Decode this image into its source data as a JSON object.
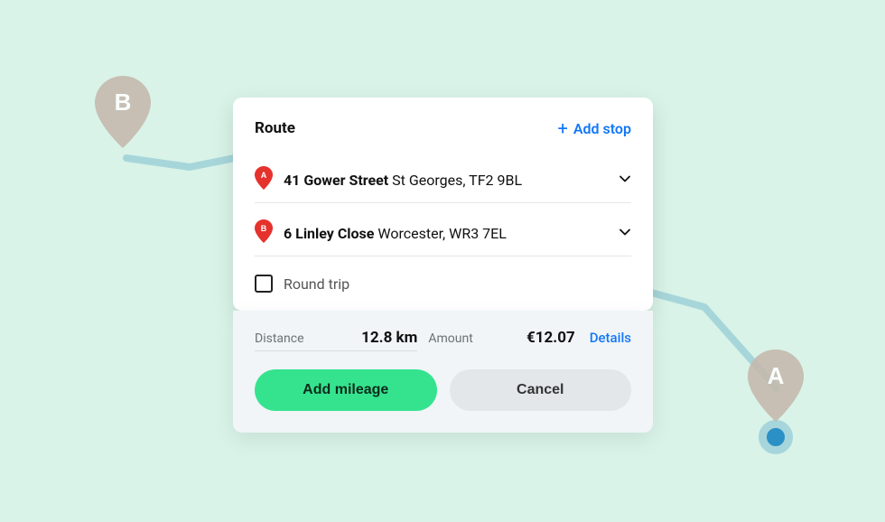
{
  "header": {
    "title": "Route",
    "add_stop": "Add stop"
  },
  "stops": [
    {
      "marker": "A",
      "street": "41 Gower Street",
      "rest": "St Georges, TF2 9BL"
    },
    {
      "marker": "B",
      "street": "6 Linley Close",
      "rest": "Worcester, WR3 7EL"
    }
  ],
  "round_trip_label": "Round trip",
  "summary": {
    "distance_label": "Distance",
    "distance_value": "12.8 km",
    "amount_label": "Amount",
    "amount_value": "€12.07",
    "details": "Details"
  },
  "buttons": {
    "primary": "Add mileage",
    "secondary": "Cancel"
  },
  "bg_markers": {
    "a": "A",
    "b": "B"
  },
  "colors": {
    "accent_blue": "#1477f8",
    "accent_green": "#35e38e",
    "pin_red": "#e5322d",
    "bg_mint": "#d9f3e8"
  }
}
